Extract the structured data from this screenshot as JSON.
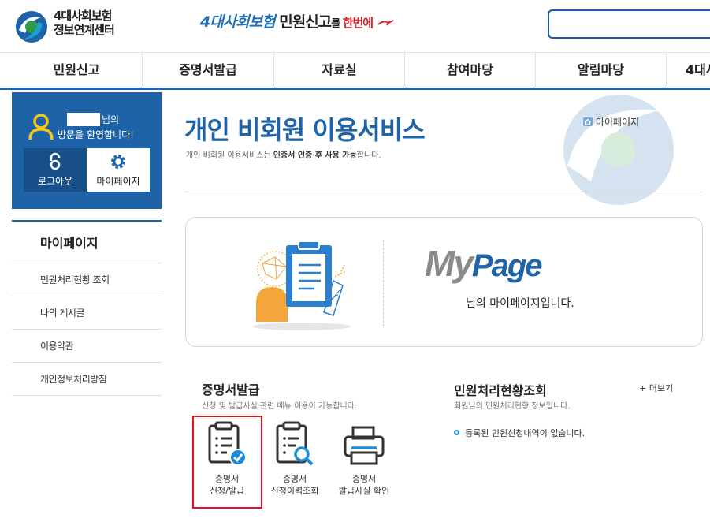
{
  "header": {
    "logo_line1": "4대사회보험",
    "logo_line2": "정보연계센터",
    "slogan_part1": "4대사회보험",
    "slogan_part2": " 민원신고",
    "slogan_part3": "를 ",
    "slogan_part4": "한번에",
    "search": {
      "placeholder": ""
    }
  },
  "nav": {
    "items": [
      {
        "label": "민원신고"
      },
      {
        "label": "증명서발급"
      },
      {
        "label": "자료실"
      },
      {
        "label": "참여마당"
      },
      {
        "label": "알림마당"
      },
      {
        "label": "4대사"
      }
    ]
  },
  "login_box": {
    "name_suffix": "님의",
    "welcome": "방문을 환영합니다!",
    "logout_label": "로그아웃",
    "mypage_label": "마이페이지"
  },
  "lnb": {
    "title": "마이페이지",
    "items": [
      {
        "label": "민원처리현황 조회"
      },
      {
        "label": "나의 게시글"
      },
      {
        "label": "이용약관"
      },
      {
        "label": "개인정보처리방침"
      }
    ]
  },
  "main": {
    "title": "개인 비회원 이용서비스",
    "desc_part1": "개인 비회원 이용서비스는 ",
    "desc_part2": "인증서 인증 후 사용 가능",
    "desc_part3": "합니다.",
    "breadcrumb": "마이페이지"
  },
  "banner": {
    "logo_my": "My",
    "logo_page": "Page",
    "message": "님의 마이페이지입니다."
  },
  "cert_section": {
    "title": "증명서발급",
    "desc": "신청 및 발급사실 관련 메뉴 이용이 가능합니다.",
    "buttons": [
      {
        "label": "증명서\n신청/발급"
      },
      {
        "label": "증명서\n신청이력조회"
      },
      {
        "label": "증명서\n발급사실 확인"
      }
    ]
  },
  "status_section": {
    "title": "민원처리현황조회",
    "desc": "회원님의 민원처리현황 정보입니다.",
    "more_label": "+ 더보기",
    "empty_message": "등록된 민원신청내역이 없습니다."
  },
  "colors": {
    "brand_blue": "#1f63a8",
    "highlight_red": "#e0141e"
  }
}
